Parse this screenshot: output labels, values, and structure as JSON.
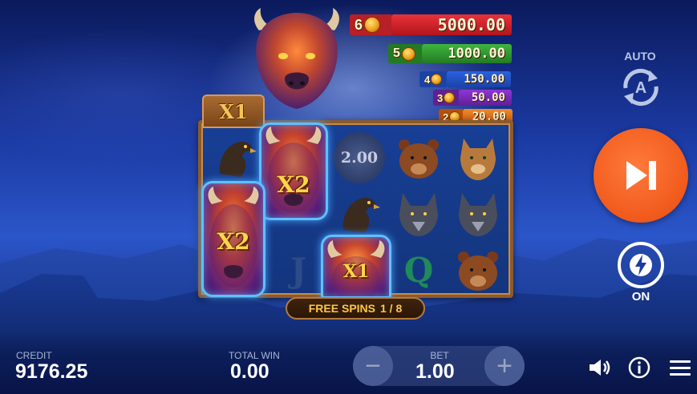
{
  "paytable": [
    {
      "count": "6",
      "value": "5000.00",
      "color": "#d9262d"
    },
    {
      "count": "5",
      "value": "1000.00",
      "color": "#2f9a2f"
    },
    {
      "count": "4",
      "value": "150.00",
      "color": "#2050c8"
    },
    {
      "count": "3",
      "value": "50.00",
      "color": "#7a2bb5"
    },
    {
      "count": "2",
      "value": "20.00",
      "color": "#e36a16"
    }
  ],
  "reel": {
    "multiplier_plaque": "X1",
    "coin_value": "2.00",
    "letters": {
      "j": "J",
      "q": "Q"
    },
    "wilds": [
      {
        "label": "X2"
      },
      {
        "label": "X2"
      },
      {
        "label": "X1"
      }
    ],
    "free_spins_label": "FREE SPINS",
    "free_spins_count": "1 / 8"
  },
  "controls": {
    "auto_label": "AUTO",
    "turbo_label": "ON",
    "accent_color": "#f05a1c"
  },
  "hud": {
    "credit_label": "CREDIT",
    "credit_value": "9176.25",
    "total_win_label": "TOTAL WIN",
    "total_win_value": "0.00",
    "bet_label": "BET",
    "bet_value": "1.00",
    "bet_minus": "−",
    "bet_plus": "+"
  },
  "icons": {
    "sound": "speaker-icon",
    "info": "info-icon",
    "menu": "hamburger-menu-icon",
    "spin": "play-skip-icon",
    "turbo": "lightning-icon",
    "auto": "autoplay-icon"
  }
}
